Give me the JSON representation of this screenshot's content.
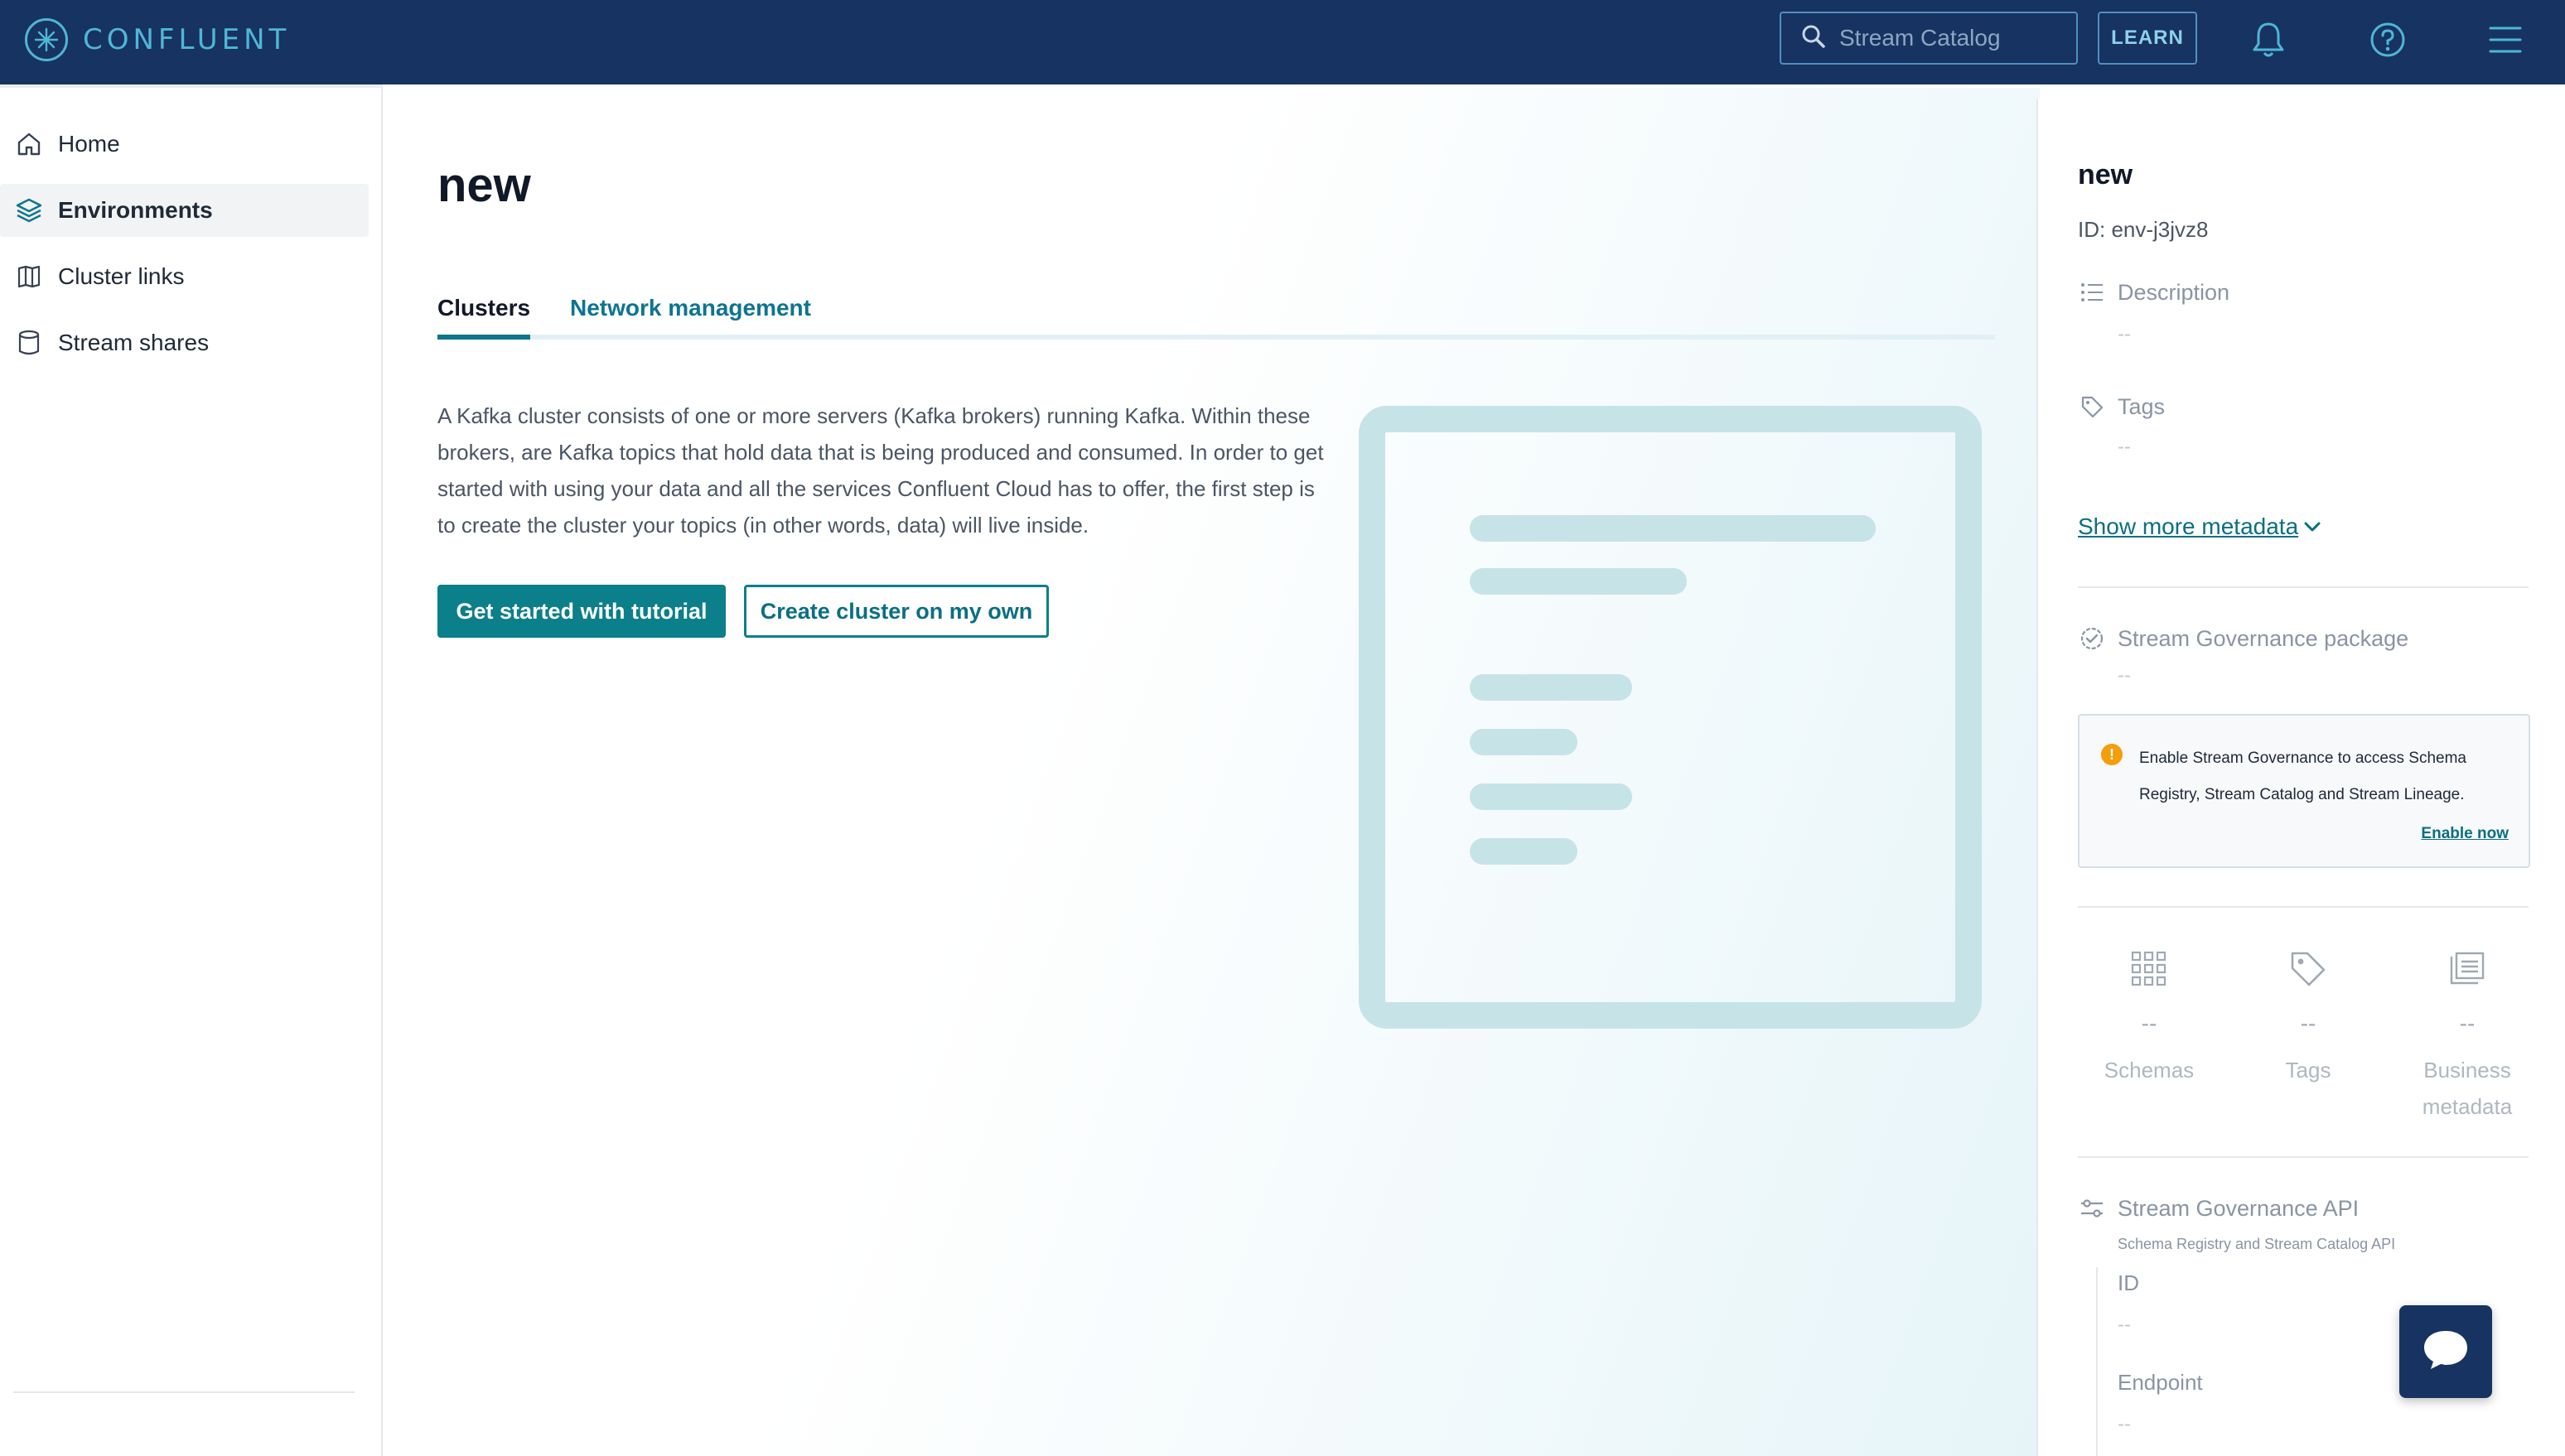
{
  "brand": {
    "name": "CONFLUENT"
  },
  "topbar": {
    "search_placeholder": "Stream Catalog",
    "learn_label": "LEARN",
    "icons": [
      "search-icon",
      "bell-icon",
      "help-icon",
      "menu-icon"
    ]
  },
  "sidebar": {
    "items": [
      {
        "label": "Home",
        "icon": "home-icon"
      },
      {
        "label": "Environments",
        "icon": "layers-icon",
        "active": true
      },
      {
        "label": "Cluster links",
        "icon": "cluster-links-icon"
      },
      {
        "label": "Stream shares",
        "icon": "database-icon"
      }
    ]
  },
  "main": {
    "title": "new",
    "tabs": [
      {
        "label": "Clusters",
        "active": true
      },
      {
        "label": "Network management"
      }
    ],
    "description": "A Kafka cluster consists of one or more servers (Kafka brokers) running Kafka. Within these brokers, are Kafka topics that hold data that is being produced and consumed. In order to get started with using your data and all the services Confluent Cloud has to offer, the first step is to create the cluster your topics (in other words, data) will live inside.",
    "primary_button": "Get started with tutorial",
    "secondary_button": "Create cluster on my own"
  },
  "details": {
    "title": "new",
    "id_text": "ID: env-j3jvz8",
    "description_label": "Description",
    "description_value": "--",
    "tags_label": "Tags",
    "tags_value": "--",
    "show_more_link": "Show more metadata",
    "governance_label": "Stream Governance package",
    "governance_value": "--",
    "notice_text": "Enable Stream Governance to access Schema Registry, Stream Catalog and Stream Lineage.",
    "notice_link": "Enable now",
    "stats": [
      {
        "label": "Schemas",
        "value": "--",
        "icon": "grid-icon"
      },
      {
        "label": "Tags",
        "value": "--",
        "icon": "tag-icon"
      },
      {
        "label": "Business metadata",
        "value": "--",
        "icon": "document-icon"
      }
    ],
    "api_label": "Stream Governance API",
    "api_sub": "Schema Registry and Stream Catalog API",
    "api_id_label": "ID",
    "api_id_value": "--",
    "api_endpoint_label": "Endpoint",
    "api_endpoint_value": "--"
  },
  "colors": {
    "topbar": "#173361",
    "accent": "#0b7f8a",
    "link": "#0b6f82",
    "warning": "#f59e0b"
  }
}
